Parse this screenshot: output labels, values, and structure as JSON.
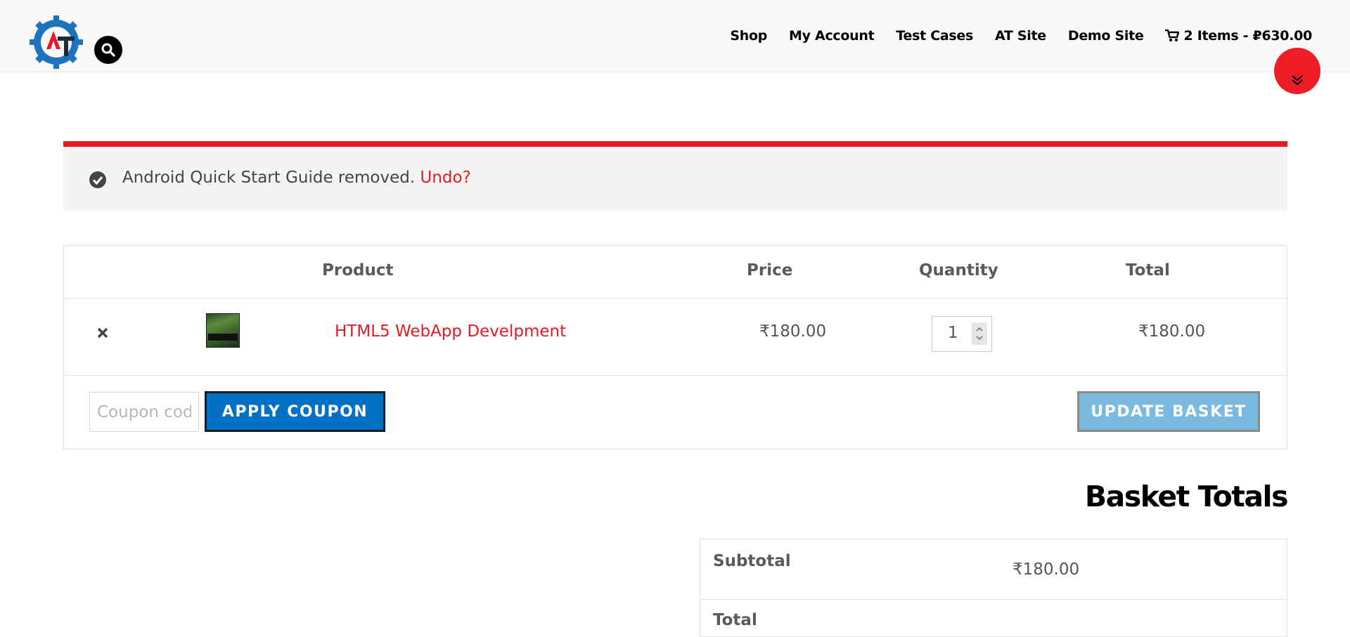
{
  "header": {
    "nav": [
      "Shop",
      "My Account",
      "Test Cases",
      "AT Site",
      "Demo Site"
    ],
    "cart_summary": "2 Items - ₽630.00",
    "logo_letters": "AT",
    "colors": {
      "logo_blue": "#1e73be",
      "logo_red": "#e41b24",
      "brand_red": "#e41b24"
    }
  },
  "notice": {
    "message": "Android Quick Start Guide removed.",
    "undo_label": "Undo?"
  },
  "cart": {
    "headers": {
      "product": "Product",
      "price": "Price",
      "quantity": "Quantity",
      "total": "Total"
    },
    "items": [
      {
        "name": "HTML5 WebApp Develpment",
        "price": "₹180.00",
        "quantity": "1",
        "total": "₹180.00"
      }
    ],
    "coupon": {
      "placeholder": "Coupon code",
      "apply_label": "APPLY COUPON"
    },
    "update_label": "UPDATE BASKET"
  },
  "totals": {
    "title": "Basket Totals",
    "subtotal_label": "Subtotal",
    "subtotal_value": "₹180.00",
    "next_label": "Total"
  }
}
